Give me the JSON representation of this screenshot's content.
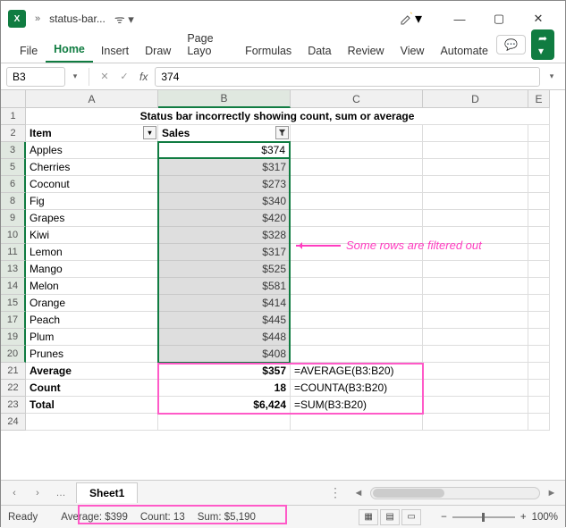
{
  "title": "status-bar...",
  "ribbon": {
    "file": "File",
    "home": "Home",
    "insert": "Insert",
    "draw": "Draw",
    "page": "Page Layo",
    "formulas": "Formulas",
    "data": "Data",
    "review": "Review",
    "view": "View",
    "automate": "Automate"
  },
  "nameBox": "B3",
  "formulaBar": "374",
  "columns": [
    "A",
    "B",
    "C",
    "D",
    "E"
  ],
  "rowLabels": [
    "1",
    "2",
    "3",
    "5",
    "6",
    "8",
    "9",
    "10",
    "11",
    "13",
    "14",
    "15",
    "17",
    "19",
    "20",
    "21",
    "22",
    "23",
    "24"
  ],
  "tableTitle": "Status bar incorrectly showing count, sum or average",
  "headers": {
    "item": "Item",
    "sales": "Sales"
  },
  "rows": [
    {
      "item": "Apples",
      "sales": "$374"
    },
    {
      "item": "Cherries",
      "sales": "$317"
    },
    {
      "item": "Coconut",
      "sales": "$273"
    },
    {
      "item": "Fig",
      "sales": "$340"
    },
    {
      "item": "Grapes",
      "sales": "$420"
    },
    {
      "item": "Kiwi",
      "sales": "$328"
    },
    {
      "item": "Lemon",
      "sales": "$317"
    },
    {
      "item": "Mango",
      "sales": "$525"
    },
    {
      "item": "Melon",
      "sales": "$581"
    },
    {
      "item": "Orange",
      "sales": "$414"
    },
    {
      "item": "Peach",
      "sales": "$445"
    },
    {
      "item": "Plum",
      "sales": "$448"
    },
    {
      "item": "Prunes",
      "sales": "$408"
    }
  ],
  "summary": [
    {
      "label": "Average",
      "value": "$357",
      "formula": "=AVERAGE(B3:B20)"
    },
    {
      "label": "Count",
      "value": "18",
      "formula": "=COUNTA(B3:B20)"
    },
    {
      "label": "Total",
      "value": "$6,424",
      "formula": "=SUM(B3:B20)"
    }
  ],
  "annotation": "Some rows are filtered out",
  "sheet": "Sheet1",
  "status": {
    "ready": "Ready",
    "avg": "Average: $399",
    "count": "Count: 13",
    "sum": "Sum: $5,190",
    "zoom": "100%"
  }
}
